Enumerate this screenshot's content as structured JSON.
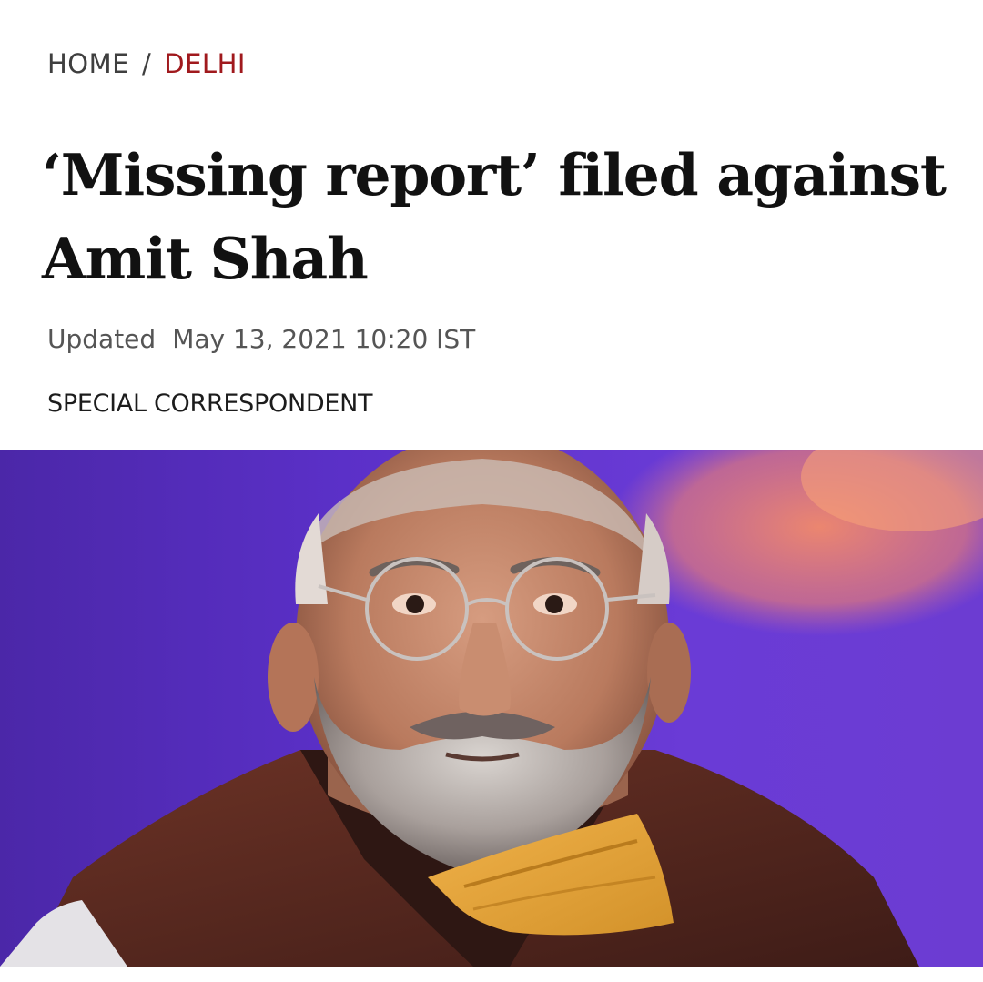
{
  "breadcrumb": {
    "home": "HOME",
    "separator": "/",
    "section": "DELHI",
    "section_color": "#a0191d"
  },
  "article": {
    "headline": "‘Missing report’ filed against Amit Shah",
    "updated_label": "Updated",
    "updated_time": "May 13, 2021 10:20 IST",
    "byline": "SPECIAL CORRESPONDENT"
  },
  "image": {
    "subject": "portrait of a man with glasses, grey beard, yellow face mask around neck",
    "background_color": "#5a2fc2"
  }
}
